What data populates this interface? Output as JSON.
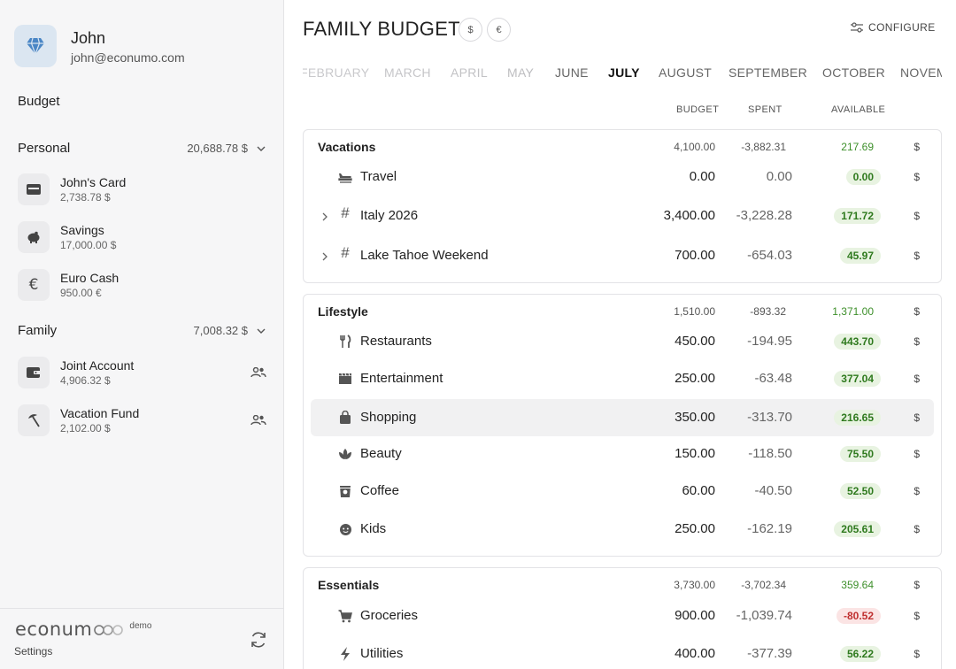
{
  "user": {
    "name": "John",
    "email": "john@econumo.com"
  },
  "nav": {
    "budget_label": "Budget"
  },
  "groups": [
    {
      "name": "Personal",
      "total": "20,688.78 $",
      "accounts": [
        {
          "name": "John's Card",
          "balance": "2,738.78 $",
          "icon": "credit-card-icon",
          "shared": false
        },
        {
          "name": "Savings",
          "balance": "17,000.00 $",
          "icon": "piggy-bank-icon",
          "shared": false
        },
        {
          "name": "Euro Cash",
          "balance": "950.00 €",
          "icon": "euro-icon",
          "shared": false
        }
      ]
    },
    {
      "name": "Family",
      "total": "7,008.32 $",
      "accounts": [
        {
          "name": "Joint Account",
          "balance": "4,906.32 $",
          "icon": "wallet-icon",
          "shared": true
        },
        {
          "name": "Vacation Fund",
          "balance": "2,102.00 $",
          "icon": "beach-umbrella-icon",
          "shared": true
        }
      ]
    }
  ],
  "footer": {
    "logo": "econum",
    "demo": "demo",
    "settings": "Settings"
  },
  "header": {
    "title": "FAMILY BUDGET",
    "currencies": [
      "$",
      "€"
    ],
    "configure": "CONFIGURE"
  },
  "months": [
    "FEBRUARY",
    "MARCH",
    "APRIL",
    "MAY",
    "JUNE",
    "JULY",
    "AUGUST",
    "SEPTEMBER",
    "OCTOBER",
    "NOVEMBER"
  ],
  "active_month": "JULY",
  "columns": {
    "budget": "BUDGET",
    "spent": "SPENT",
    "available": "AVAILABLE"
  },
  "categories": [
    {
      "name": "Vacations",
      "budget": "4,100.00",
      "spent": "-3,882.31",
      "available": "217.69",
      "currency": "$",
      "items": [
        {
          "name": "Travel",
          "icon": "airplane-icon",
          "budget": "0.00",
          "spent": "0.00",
          "available": "0.00",
          "currency": "$",
          "expandable": false
        },
        {
          "name": "Italy 2026",
          "icon": "hash-icon",
          "budget": "3,400.00",
          "spent": "-3,228.28",
          "available": "171.72",
          "currency": "$",
          "expandable": true
        },
        {
          "name": "Lake Tahoe Weekend",
          "icon": "hash-icon",
          "budget": "700.00",
          "spent": "-654.03",
          "available": "45.97",
          "currency": "$",
          "expandable": true
        }
      ]
    },
    {
      "name": "Lifestyle",
      "budget": "1,510.00",
      "spent": "-893.32",
      "available": "1,371.00",
      "currency": "$",
      "items": [
        {
          "name": "Restaurants",
          "icon": "fork-knife-icon",
          "budget": "450.00",
          "spent": "-194.95",
          "available": "443.70",
          "currency": "$"
        },
        {
          "name": "Entertainment",
          "icon": "clapperboard-icon",
          "budget": "250.00",
          "spent": "-63.48",
          "available": "377.04",
          "currency": "$"
        },
        {
          "name": "Shopping",
          "icon": "shopping-bag-icon",
          "budget": "350.00",
          "spent": "-313.70",
          "available": "216.65",
          "currency": "$"
        },
        {
          "name": "Beauty",
          "icon": "spa-icon",
          "budget": "150.00",
          "spent": "-118.50",
          "available": "75.50",
          "currency": "$"
        },
        {
          "name": "Coffee",
          "icon": "coffee-cup-icon",
          "budget": "60.00",
          "spent": "-40.50",
          "available": "52.50",
          "currency": "$"
        },
        {
          "name": "Kids",
          "icon": "child-face-icon",
          "budget": "250.00",
          "spent": "-162.19",
          "available": "205.61",
          "currency": "$"
        }
      ]
    },
    {
      "name": "Essentials",
      "budget": "3,730.00",
      "spent": "-3,702.34",
      "available": "359.64",
      "currency": "$",
      "items": [
        {
          "name": "Groceries",
          "icon": "shopping-cart-icon",
          "budget": "900.00",
          "spent": "-1,039.74",
          "available": "-80.52",
          "currency": "$"
        },
        {
          "name": "Utilities",
          "icon": "bolt-icon",
          "budget": "400.00",
          "spent": "-377.39",
          "available": "56.22",
          "currency": "$"
        }
      ]
    }
  ]
}
